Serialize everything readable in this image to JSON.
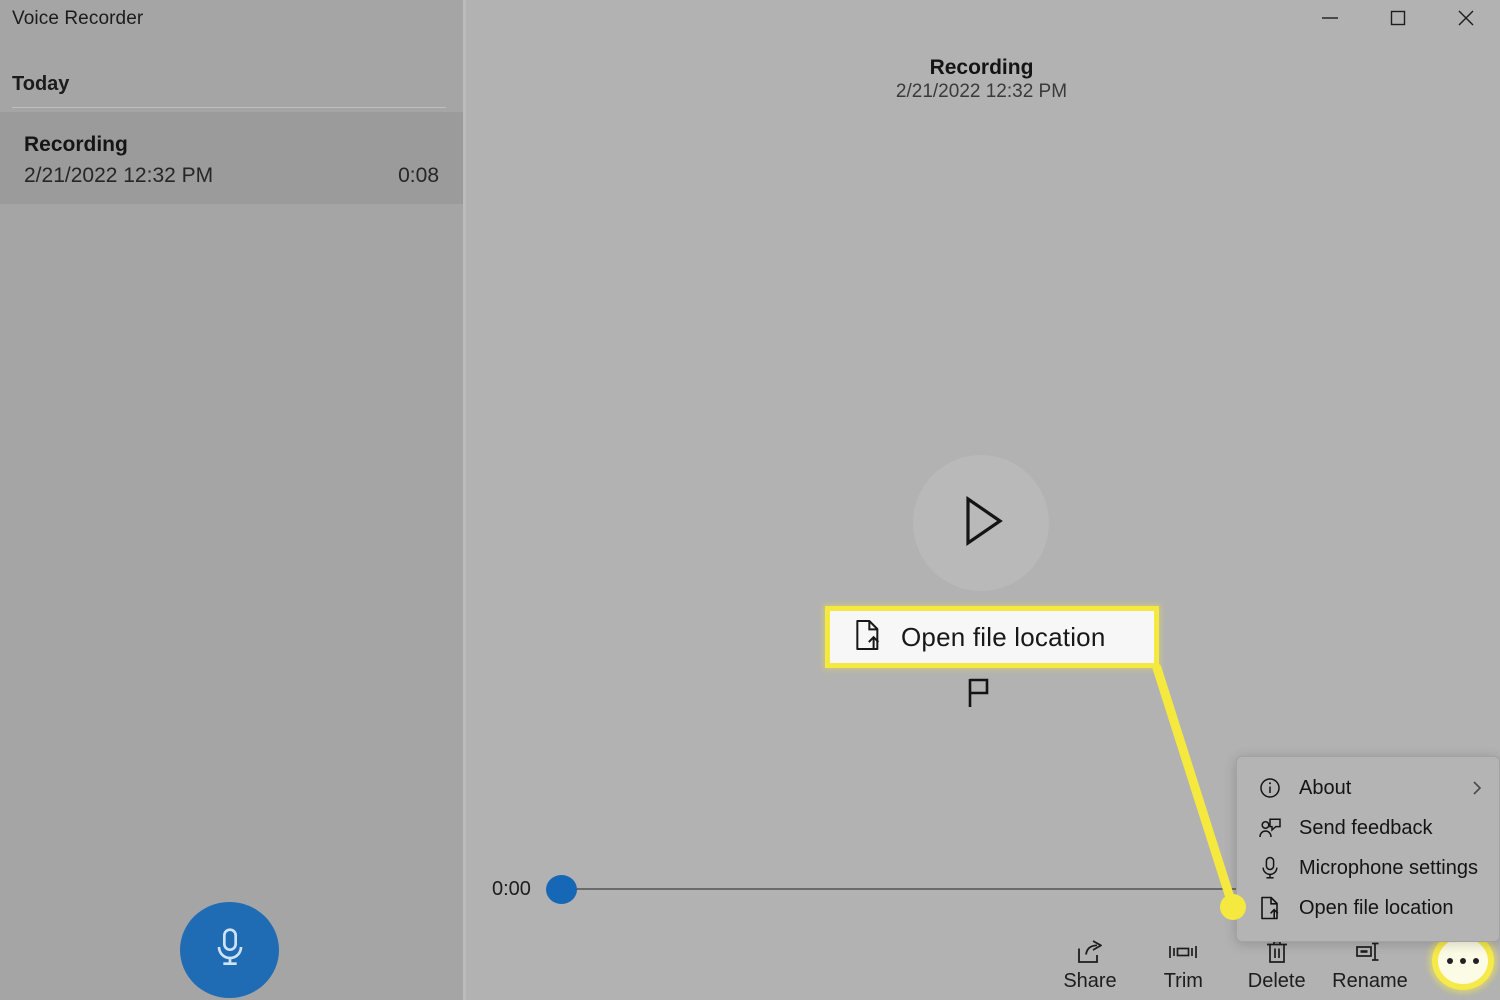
{
  "window": {
    "app_title": "Voice Recorder",
    "controls": [
      {
        "name": "minimize",
        "glyph": "minimize-icon"
      },
      {
        "name": "maximize",
        "glyph": "maximize-icon"
      },
      {
        "name": "close",
        "glyph": "close-icon"
      }
    ]
  },
  "sidebar": {
    "group_label": "Today",
    "recordings": [
      {
        "name": "Recording",
        "date": "2/21/2022 12:32 PM",
        "duration": "0:08",
        "selected": true
      }
    ],
    "record_button": {
      "icon": "microphone-icon",
      "color": "#1f6cb5"
    }
  },
  "main": {
    "title": "Recording",
    "subtitle": "2/21/2022 12:32 PM",
    "play_button": {
      "icon": "play-icon"
    },
    "player": {
      "current_time": "0:00",
      "progress_percent": 0,
      "thumb_color": "#1667b5"
    },
    "toolbar": [
      {
        "label": "Share",
        "icon": "share-icon"
      },
      {
        "label": "Trim",
        "icon": "trim-icon"
      },
      {
        "label": "Delete",
        "icon": "trash-icon"
      },
      {
        "label": "Rename",
        "icon": "rename-icon"
      }
    ],
    "more_button": {
      "icon": "ellipsis-icon",
      "highlight_color": "#f6e94a"
    }
  },
  "context_menu": {
    "items": [
      {
        "label": "About",
        "icon": "info-circle-icon",
        "chevron": "chevron-right-icon"
      },
      {
        "label": "Send feedback",
        "icon": "feedback-icon",
        "chevron": ""
      },
      {
        "label": "Microphone settings",
        "icon": "microphone-icon",
        "chevron": ""
      },
      {
        "label": "Open file location",
        "icon": "open-file-icon",
        "chevron": ""
      }
    ]
  },
  "annotation": {
    "callout_label": "Open file location",
    "callout_icon": "open-file-icon",
    "flag_icon": "flag-icon",
    "highlight_color": "#f5e83f"
  }
}
